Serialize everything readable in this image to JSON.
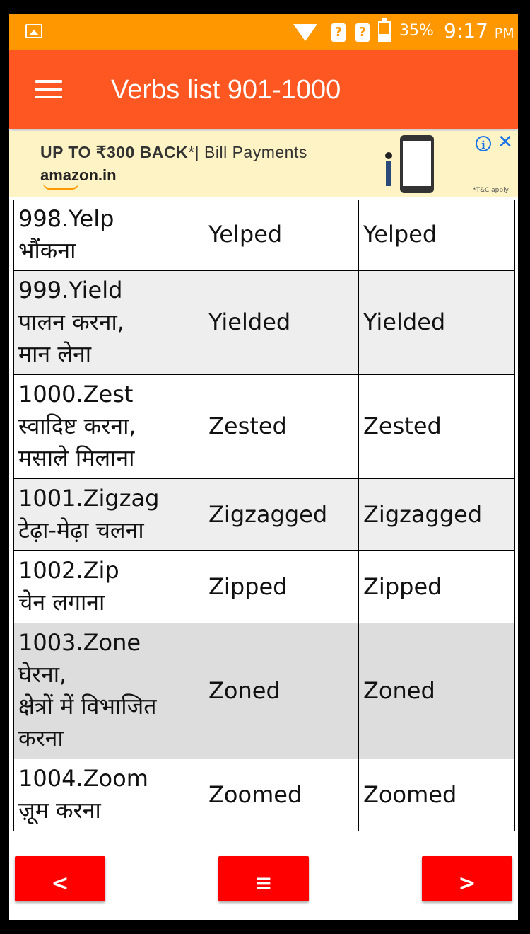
{
  "status_bar": {
    "battery_percent": "35%",
    "battery_level": 0.35,
    "time": "9:17",
    "ampm": "PM",
    "icons": [
      "gallery-icon",
      "wifi-icon",
      "unknown-sim-icon",
      "unknown-sim-icon",
      "battery-icon"
    ]
  },
  "app_bar": {
    "title": "Verbs list 901-1000",
    "menu_icon": "hamburger-icon"
  },
  "ad": {
    "headline_bold": "UP TO ₹300 BACK",
    "headline_rest": "*| Bill Payments",
    "brand": "amazon.in",
    "terms": "*T&C apply",
    "info_icon": "i",
    "close_icon": "✕"
  },
  "table": {
    "rows": [
      {
        "verb": "998.Yelp",
        "meaning": [
          "भौंकना"
        ],
        "past": "Yelped",
        "participle": "Yelped",
        "shade": "#ffffff"
      },
      {
        "verb": "999.Yield",
        "meaning": [
          "पालन करना,",
          "मान लेना"
        ],
        "past": "Yielded",
        "participle": "Yielded",
        "shade": "#eeeeee"
      },
      {
        "verb": "1000.Zest",
        "meaning": [
          "स्वादिष्ट करना,",
          "मसाले मिलाना"
        ],
        "past": "Zested",
        "participle": "Zested",
        "shade": "#ffffff"
      },
      {
        "verb": "1001.Zigzag",
        "meaning": [
          "टेढ़ा-मेढ़ा चलना"
        ],
        "past": "Zigzagged",
        "participle": "Zigzagged",
        "shade": "#eeeeee"
      },
      {
        "verb": "1002.Zip",
        "meaning": [
          "चेन लगाना"
        ],
        "past": "Zipped",
        "participle": "Zipped",
        "shade": "#ffffff"
      },
      {
        "verb": "1003.Zone",
        "meaning": [
          "घेरना,",
          "क्षेत्रों में विभाजित",
          "करना"
        ],
        "past": "Zoned",
        "participle": "Zoned",
        "shade": "#dddddd"
      },
      {
        "verb": "1004.Zoom",
        "meaning": [
          "ज़ूम करना"
        ],
        "past": "Zoomed",
        "participle": "Zoomed",
        "shade": "#ffffff"
      }
    ]
  },
  "nav": {
    "prev_label": "<",
    "menu_label": "≡",
    "next_label": ">",
    "button_color": "#ff0000"
  },
  "colors": {
    "status_bar": "#ff9800",
    "app_bar": "#ff5722",
    "ad_background": "#fdf3c4"
  }
}
